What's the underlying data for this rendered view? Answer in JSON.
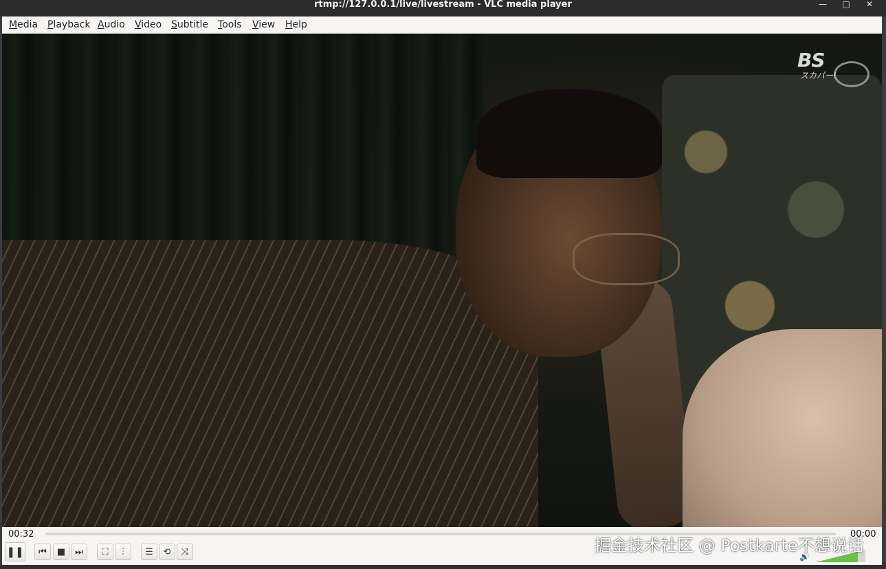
{
  "window": {
    "title": "rtmp://127.0.0.1/live/livestream - VLC media player",
    "minimize_glyph": "—",
    "maximize_glyph": "□",
    "close_glyph": "✕"
  },
  "menu": [
    {
      "label": "Media",
      "mnemonic": "M"
    },
    {
      "label": "Playback",
      "mnemonic": "P"
    },
    {
      "label": "Audio",
      "mnemonic": "A"
    },
    {
      "label": "Video",
      "mnemonic": "V"
    },
    {
      "label": "Subtitle",
      "mnemonic": "S"
    },
    {
      "label": "Tools",
      "mnemonic": "T"
    },
    {
      "label": "View",
      "mnemonic": "V"
    },
    {
      "label": "Help",
      "mnemonic": "H"
    }
  ],
  "video": {
    "logo_text": "BS",
    "logo_sub": "スカパー!"
  },
  "controls": {
    "elapsed": "00:32",
    "remaining": "00:00",
    "progress": 0,
    "volume": 0.85,
    "buttons": {
      "pause": "❚❚",
      "previous": "⏮",
      "stop": "■",
      "next": "⏭",
      "fullscreen": "⛶",
      "extended": "⫶",
      "playlist": "☰",
      "loop": "⟲",
      "random": "⤨"
    },
    "volume_icon": "🔊"
  },
  "overlay": {
    "watermark": "掘金技术社区 @ Postkarte不想说话"
  },
  "colors": {
    "titlebar": "#2c2c2c",
    "menubar": "#f6f5f4",
    "volume_fill": "#6bc24a"
  }
}
